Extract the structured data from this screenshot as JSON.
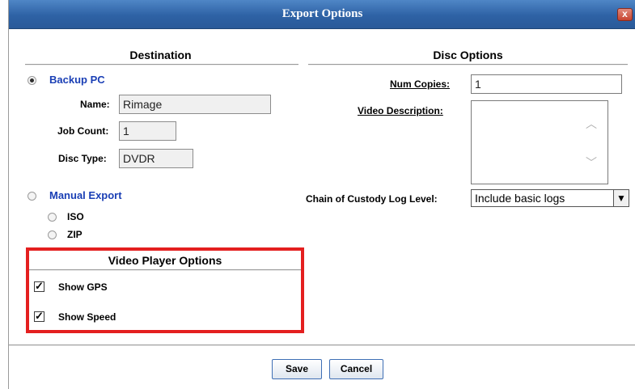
{
  "window": {
    "title": "Export Options",
    "close_label": "x"
  },
  "destination": {
    "title": "Destination",
    "backup_pc": {
      "label": "Backup PC",
      "selected": true,
      "name_label": "Name:",
      "name_value": "Rimage",
      "job_count_label": "Job Count:",
      "job_count_value": "1",
      "disc_type_label": "Disc Type:",
      "disc_type_value": "DVDR"
    },
    "manual_export": {
      "label": "Manual Export",
      "selected": false,
      "options": [
        {
          "label": "ISO",
          "selected": false
        },
        {
          "label": "ZIP",
          "selected": false
        }
      ]
    }
  },
  "video_player_options": {
    "title": "Video Player Options",
    "show_gps": {
      "label": "Show GPS",
      "checked": true
    },
    "show_speed": {
      "label": "Show Speed",
      "checked": true
    },
    "check_mark": "✓"
  },
  "disc_options": {
    "title": "Disc Options",
    "num_copies_label": "Num Copies:",
    "num_copies_value": "1",
    "video_description_label": "Video Description:",
    "video_description_value": "",
    "chain_label": "Chain of Custody Log Level:",
    "chain_value": "Include basic logs"
  },
  "buttons": {
    "save": "Save",
    "cancel": "Cancel"
  },
  "colors": {
    "title_bar": "#2e62a5",
    "highlight_box": "#e41f1f",
    "radio_label": "#1a3fb5"
  }
}
